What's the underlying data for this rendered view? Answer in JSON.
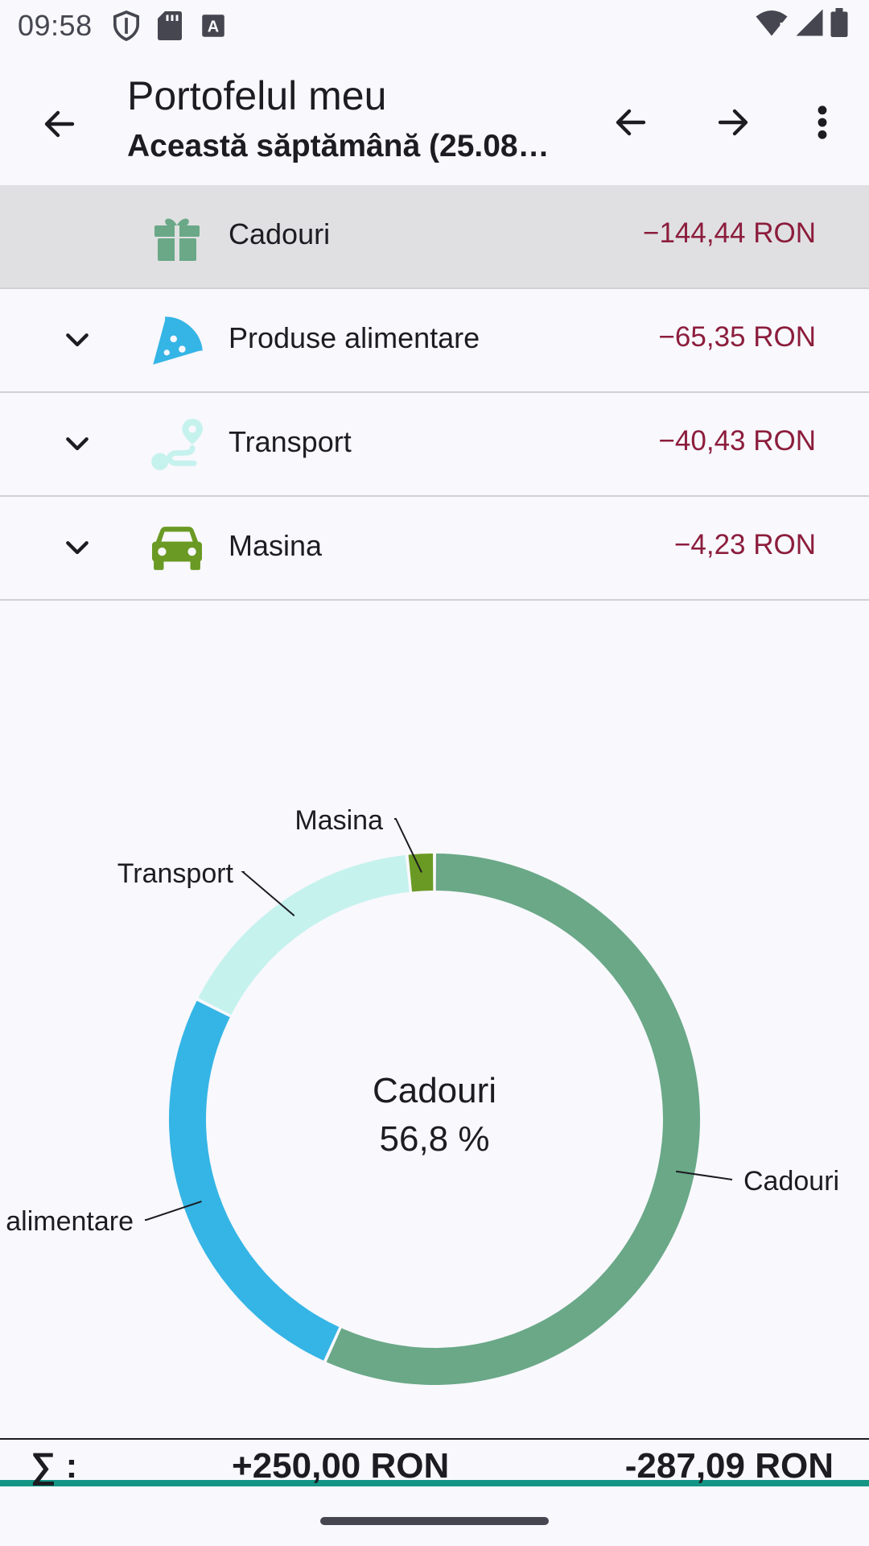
{
  "status_bar": {
    "time": "09:58",
    "icons": [
      "shield-icon",
      "sd-card-icon",
      "text-a-icon"
    ],
    "right_icons": [
      "wifi-icon",
      "signal-icon",
      "battery-icon"
    ]
  },
  "app_bar": {
    "title": "Portofelul meu",
    "subtitle": "Această săptămână (25.08…",
    "icons": [
      "back-arrow-icon",
      "prev-arrow-icon",
      "next-arrow-icon",
      "more-vert-icon"
    ]
  },
  "categories": [
    {
      "name": "Cadouri",
      "amount": "−144,44 RON",
      "icon": "gift-icon",
      "color": "#6aa887",
      "expandable": false,
      "selected": true
    },
    {
      "name": "Produse alimentare",
      "amount": "−65,35 RON",
      "icon": "pizza-icon",
      "color": "#35b5e5",
      "expandable": true,
      "selected": false
    },
    {
      "name": "Transport",
      "amount": "−40,43 RON",
      "icon": "route-icon",
      "color": "#c6f2ee",
      "expandable": true,
      "selected": false
    },
    {
      "name": "Masina",
      "amount": "−4,23 RON",
      "icon": "car-icon",
      "color": "#6a9a23",
      "expandable": true,
      "selected": false
    }
  ],
  "chart_data": {
    "type": "pie",
    "style": "donut",
    "categories": [
      "Cadouri",
      "Produse alimentare",
      "Transport",
      "Masina"
    ],
    "values": [
      144.44,
      65.35,
      40.43,
      4.23
    ],
    "colors": [
      "#6aa887",
      "#35b5e5",
      "#c6f2ee",
      "#6a9a23"
    ],
    "outside_labels": [
      "Cadouri",
      "alimentare",
      "Transport",
      "Masina"
    ],
    "center_label": "Cadouri",
    "center_value": "56,8 %"
  },
  "footer": {
    "sum_label": "∑ :",
    "income": "+250,00 RON",
    "expense": "-287,09 RON"
  }
}
